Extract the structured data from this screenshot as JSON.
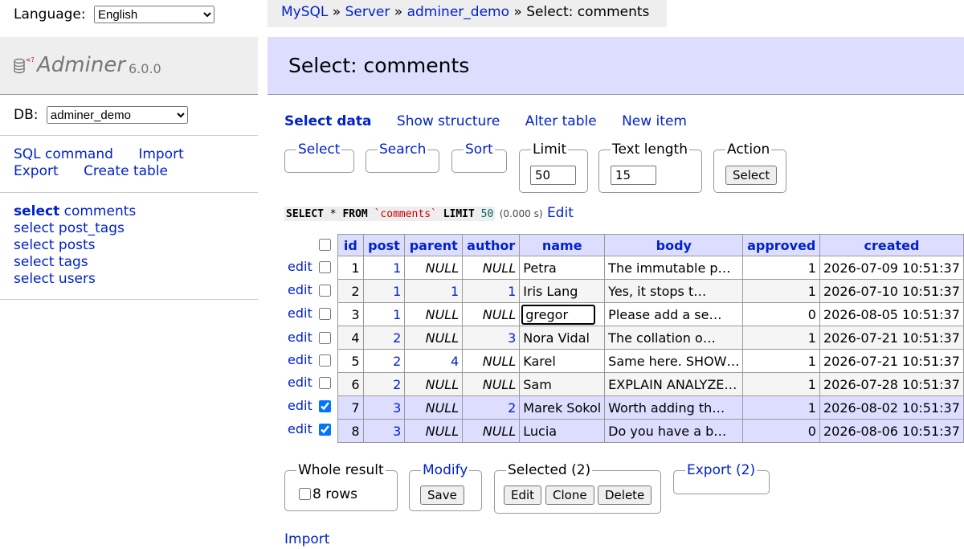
{
  "breadcrumb": {
    "mysql": "MySQL",
    "sep": "»",
    "server": "Server",
    "db": "adminer_demo",
    "current": "Select: comments"
  },
  "menu": {
    "language_label": "Language:",
    "language_value": "English",
    "logo_name": "Adminer",
    "logo_version": "6.0.0",
    "db_label": "DB:",
    "db_value": "adminer_demo",
    "links": {
      "sql_command": "SQL command",
      "import": "Import",
      "export": "Export",
      "create_table": "Create table"
    },
    "tables": [
      {
        "prefix": "select",
        "name": "comments",
        "active": true
      },
      {
        "prefix": "select",
        "name": "post_tags"
      },
      {
        "prefix": "select",
        "name": "posts"
      },
      {
        "prefix": "select",
        "name": "tags"
      },
      {
        "prefix": "select",
        "name": "users"
      }
    ]
  },
  "page_title": "Select: comments",
  "tabs": {
    "select_data": "Select data",
    "show_structure": "Show structure",
    "alter_table": "Alter table",
    "new_item": "New item"
  },
  "filters": {
    "select": "Select",
    "search": "Search",
    "sort": "Sort",
    "limit_label": "Limit",
    "limit_value": "50",
    "text_length_label": "Text length",
    "text_length_value": "15",
    "action_label": "Action",
    "action_button": "Select"
  },
  "sql": {
    "select": "SELECT",
    "star": "*",
    "from": "FROM",
    "table": "`comments`",
    "limit": "LIMIT",
    "limit_n": "50",
    "time": "(0.000 s)",
    "edit": "Edit"
  },
  "table": {
    "columns": [
      "id",
      "post",
      "parent",
      "author",
      "name",
      "body",
      "approved",
      "created"
    ],
    "edit_label": "edit",
    "rows": [
      {
        "id": "1",
        "post": "1",
        "parent": "NULL",
        "author": "NULL",
        "name": "Petra",
        "body": "The immutable p…",
        "approved": "1",
        "created": "2026-07-09 10:51:37",
        "checked": false
      },
      {
        "id": "2",
        "post": "1",
        "parent": "1",
        "author": "1",
        "name": "Iris Lang",
        "body": "Yes, it stops t…",
        "approved": "1",
        "created": "2026-07-10 10:51:37",
        "checked": false
      },
      {
        "id": "3",
        "post": "1",
        "parent": "NULL",
        "author": "NULL",
        "name": "gregor",
        "body": "Please add a se…",
        "approved": "0",
        "created": "2026-08-05 10:51:37",
        "checked": false,
        "editing": true
      },
      {
        "id": "4",
        "post": "2",
        "parent": "NULL",
        "author": "3",
        "name": "Nora Vidal",
        "body": "The collation o…",
        "approved": "1",
        "created": "2026-07-21 10:51:37",
        "checked": false
      },
      {
        "id": "5",
        "post": "2",
        "parent": "4",
        "author": "NULL",
        "name": "Karel",
        "body": "Same here. SHOW…",
        "approved": "1",
        "created": "2026-07-21 10:51:37",
        "checked": false
      },
      {
        "id": "6",
        "post": "2",
        "parent": "NULL",
        "author": "NULL",
        "name": "Sam",
        "body": "EXPLAIN ANALYZE…",
        "approved": "1",
        "created": "2026-07-28 10:51:37",
        "checked": false
      },
      {
        "id": "7",
        "post": "3",
        "parent": "NULL",
        "author": "2",
        "name": "Marek Sokol",
        "body": "Worth adding th…",
        "approved": "1",
        "created": "2026-08-02 10:51:37",
        "checked": true
      },
      {
        "id": "8",
        "post": "3",
        "parent": "NULL",
        "author": "NULL",
        "name": "Lucia",
        "body": "Do you have a b…",
        "approved": "0",
        "created": "2026-08-06 10:51:37",
        "checked": true
      }
    ]
  },
  "bottom": {
    "whole_result": "Whole result",
    "rows_label": "8 rows",
    "modify": "Modify",
    "save": "Save",
    "selected": "Selected (2)",
    "edit": "Edit",
    "clone": "Clone",
    "delete": "Delete",
    "export": "Export (2)",
    "import": "Import"
  }
}
